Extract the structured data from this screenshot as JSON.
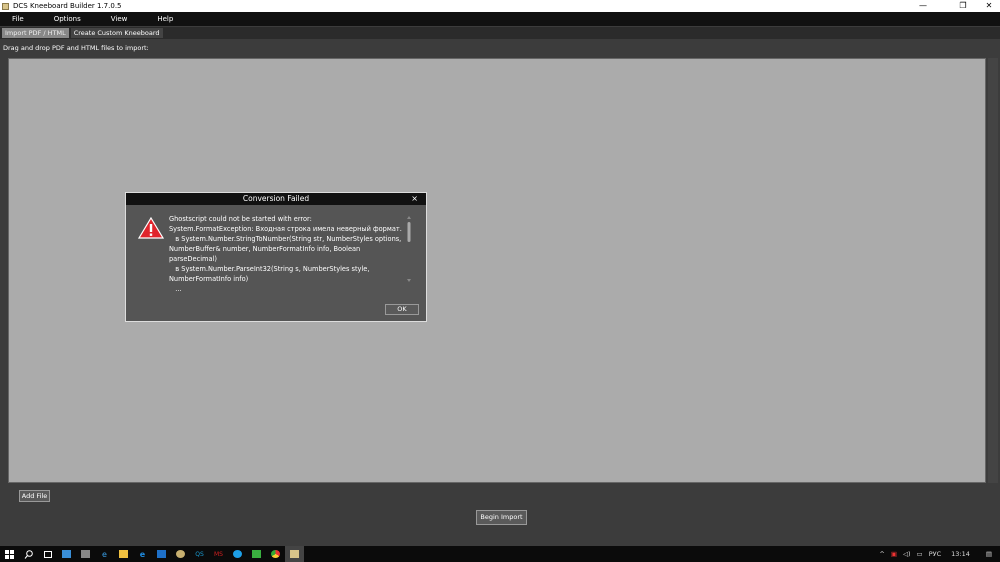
{
  "window": {
    "title": "DCS Kneeboard Builder 1.7.0.5",
    "minimize": "—",
    "restore": "❐",
    "close": "✕"
  },
  "menu": [
    "File",
    "Options",
    "View",
    "Help"
  ],
  "tabs": [
    {
      "label": "Import PDF / HTML",
      "active": true
    },
    {
      "label": "Create Custom Kneeboard",
      "active": false
    }
  ],
  "hint": "Drag and drop PDF and HTML files to import:",
  "add_file": "Add File",
  "begin_import": "Begin Import",
  "dialog": {
    "title": "Conversion Failed",
    "close": "×",
    "message": "Ghostscript could not be started with error:\nSystem.FormatException: Входная строка имела неверный формат.\n   в System.Number.StringToNumber(String str, NumberStyles options, NumberBuffer& number, NumberFormatInfo info, Boolean parseDecimal)\n   в System.Number.ParseInt32(String s, NumberStyles style, NumberFormatInfo info)\n   ...",
    "ok": "OK"
  },
  "taskbar": {
    "icons": [
      "start-icon",
      "search-icon",
      "task-view-icon",
      "mail-icon",
      "app-icon",
      "ie-icon",
      "explorer-icon",
      "edge-icon",
      "outlook-icon",
      "app2-icon",
      "qs-icon",
      "mc-icon",
      "info-icon",
      "green-app-icon",
      "chrome-icon",
      "kneeboard-icon"
    ],
    "tray": {
      "lang": "РУС",
      "time": "13:14"
    }
  },
  "colors": {
    "warn": "#e0242c",
    "drop": "#ababab"
  }
}
